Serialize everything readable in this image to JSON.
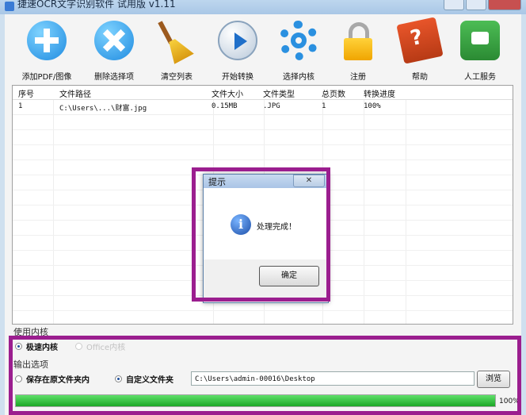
{
  "window": {
    "title": "捷速OCR文字识别软件 试用版 v1.11"
  },
  "toolbar": [
    {
      "label": "添加PDF/图像",
      "icon": "add-icon"
    },
    {
      "label": "删除选择项",
      "icon": "delete-icon"
    },
    {
      "label": "清空列表",
      "icon": "broom-icon"
    },
    {
      "label": "开始转换",
      "icon": "play-icon"
    },
    {
      "label": "选择内核",
      "icon": "gear-icon"
    },
    {
      "label": "注册",
      "icon": "lock-icon"
    },
    {
      "label": "帮助",
      "icon": "help-book-icon"
    },
    {
      "label": "人工服务",
      "icon": "phone-icon"
    }
  ],
  "table": {
    "headers": [
      "序号",
      "文件路径",
      "文件大小",
      "文件类型",
      "总页数",
      "转换进度"
    ],
    "rows": [
      [
        "1",
        "C:\\Users\\...\\财富.jpg",
        "0.15MB",
        ".JPG",
        "1",
        "100%"
      ]
    ]
  },
  "dialog": {
    "title": "提示",
    "close": "✕",
    "message": "处理完成！",
    "ok": "确定"
  },
  "engine": {
    "label": "使用内核",
    "options": [
      "极速内核",
      "Office内核"
    ],
    "selected": 0
  },
  "output": {
    "label": "输出选项",
    "options": [
      "保存在原文件夹内",
      "自定义文件夹"
    ],
    "selected": 1,
    "path": "C:\\Users\\admin-00016\\Desktop",
    "browse": "浏览"
  },
  "progress": {
    "value": 1.0,
    "text": "100%"
  },
  "colors": {
    "highlight": "#9b1e8f",
    "progress": "#1ba726"
  }
}
